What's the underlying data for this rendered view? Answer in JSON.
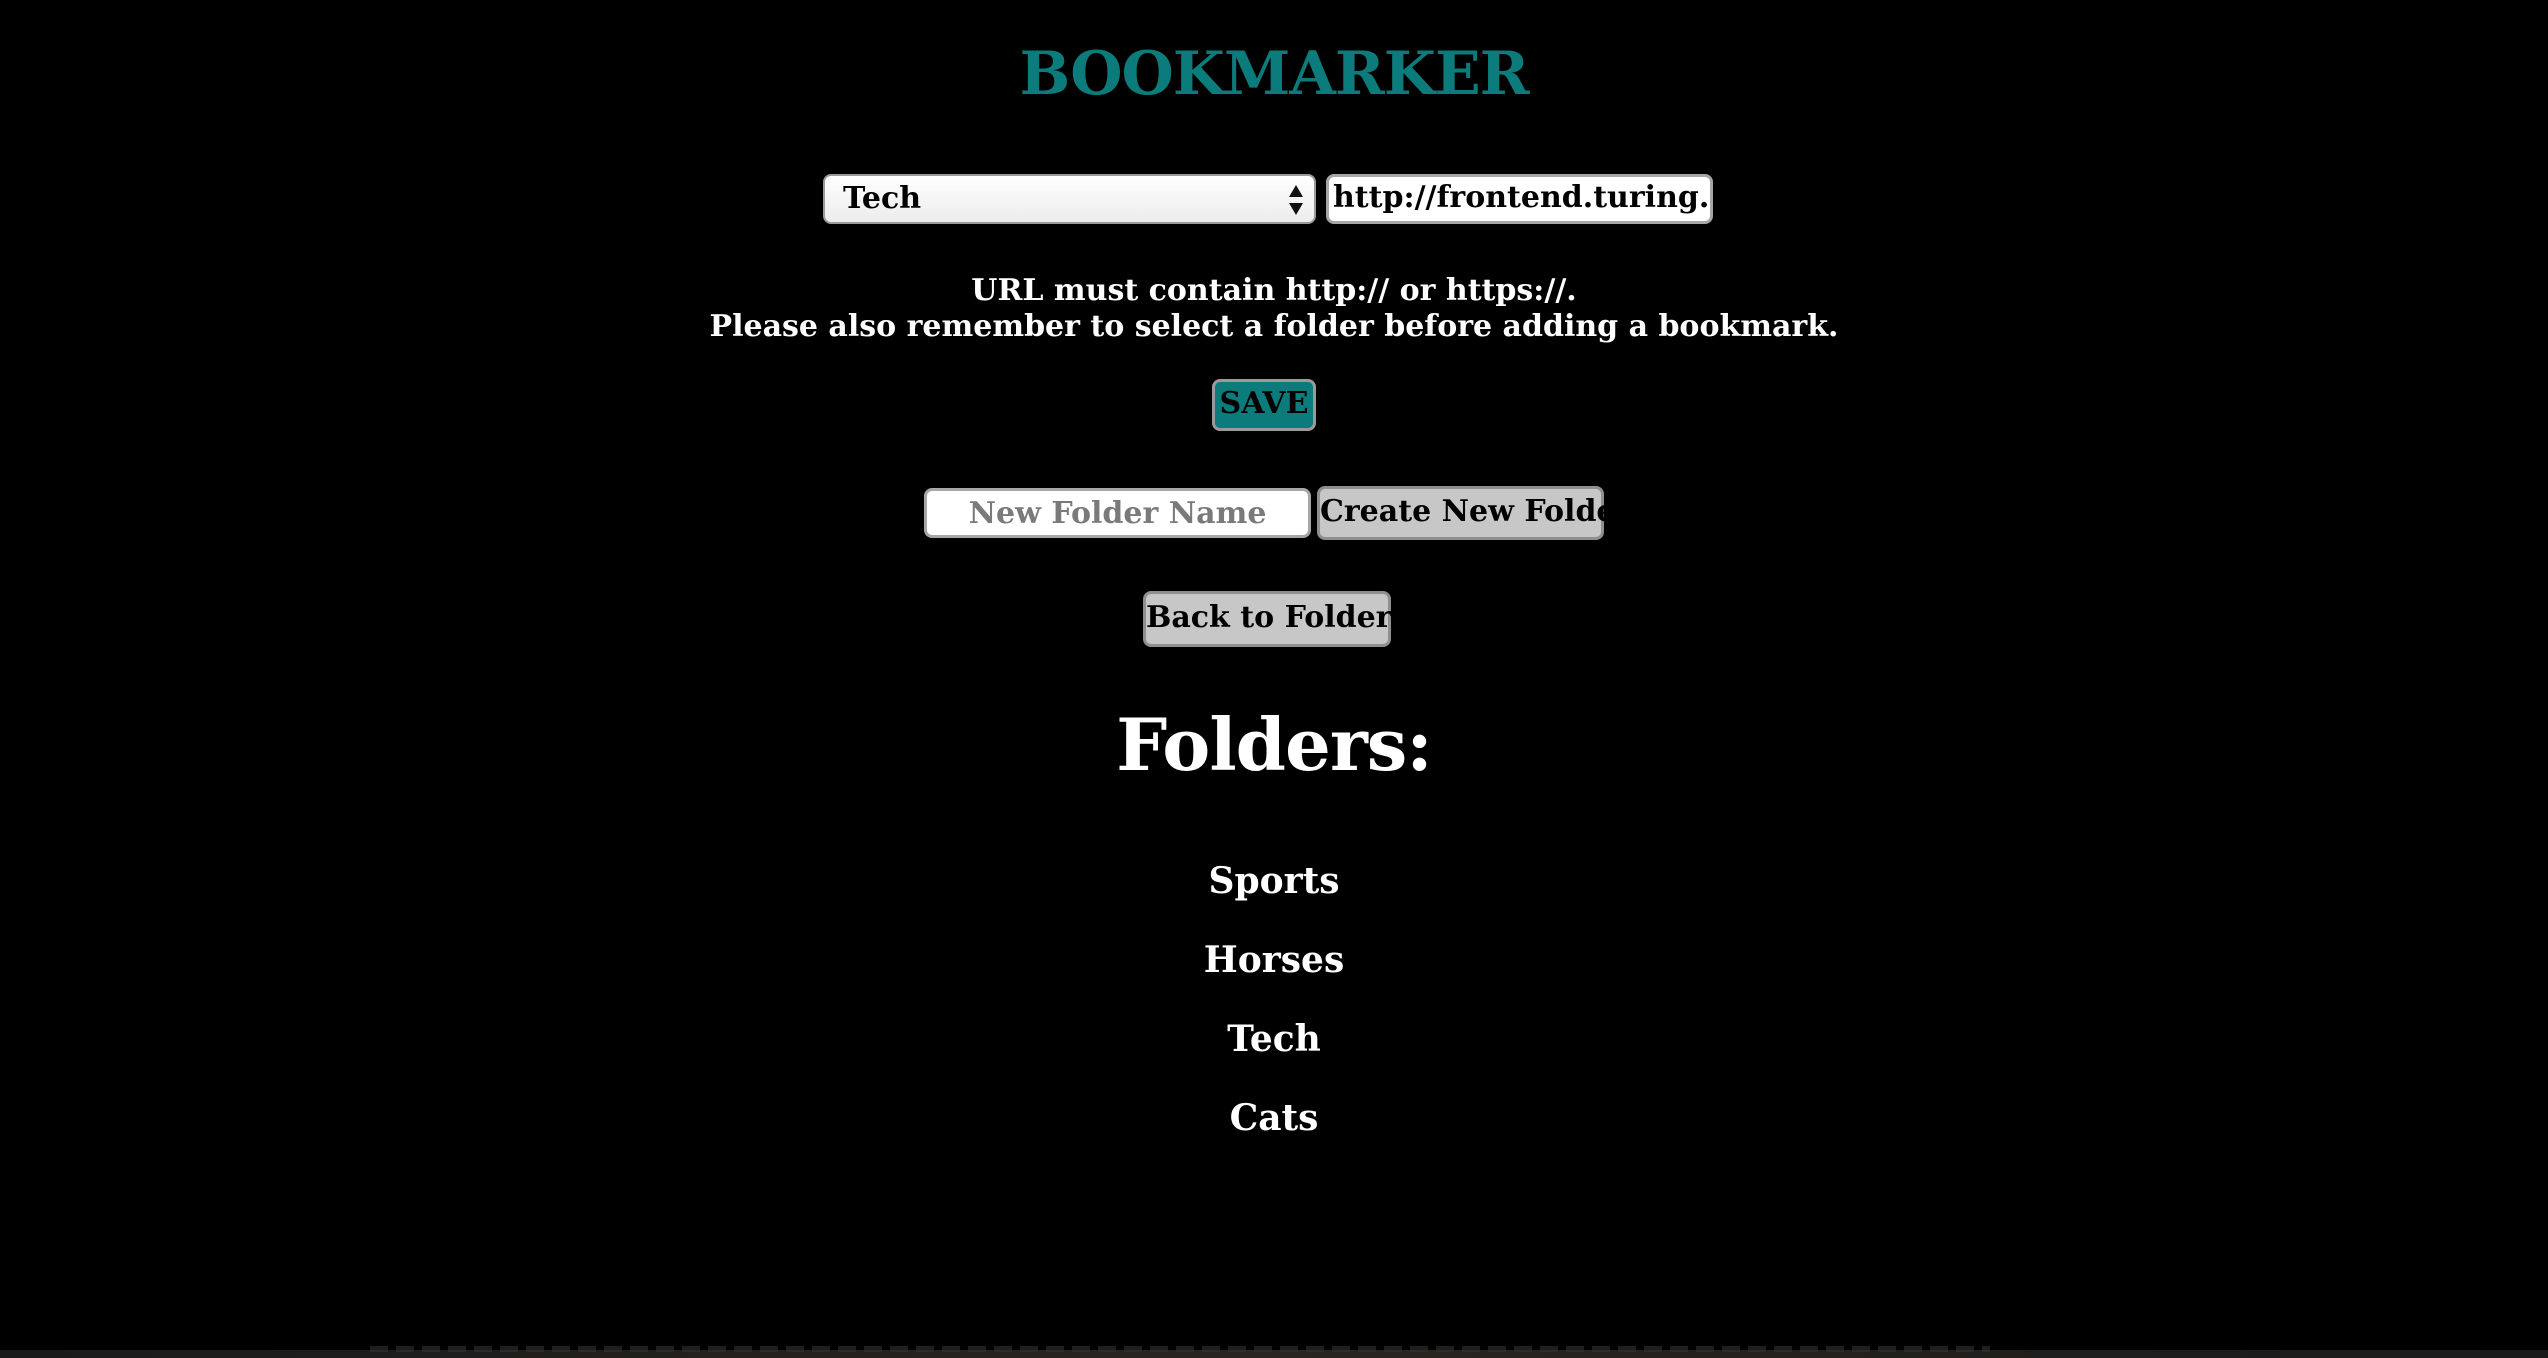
{
  "header": {
    "title": "BOOKMARKER"
  },
  "bookmark_form": {
    "folder_select": {
      "selected": "Tech"
    },
    "url_input": {
      "value": "http://frontend.turing.io/p"
    },
    "notice_line_1": "URL must contain http:// or https://.",
    "notice_line_2": "Please also remember to select a folder before adding a bookmark.",
    "save_label": "SAVE"
  },
  "folder_form": {
    "name_placeholder": "New Folder Name",
    "create_label": "Create New Folder"
  },
  "back_label": "Back to Folders",
  "folders": {
    "heading": "Folders:",
    "items": [
      {
        "label": "Sports"
      },
      {
        "label": "Horses"
      },
      {
        "label": "Tech"
      },
      {
        "label": "Cats"
      }
    ]
  },
  "colors": {
    "background": "#000000",
    "accent": "#0b7b7b",
    "button_gray": "#c7c7c7",
    "text": "#ffffff"
  },
  "icons": {
    "select_arrows": "up-down-chevron-icon"
  }
}
